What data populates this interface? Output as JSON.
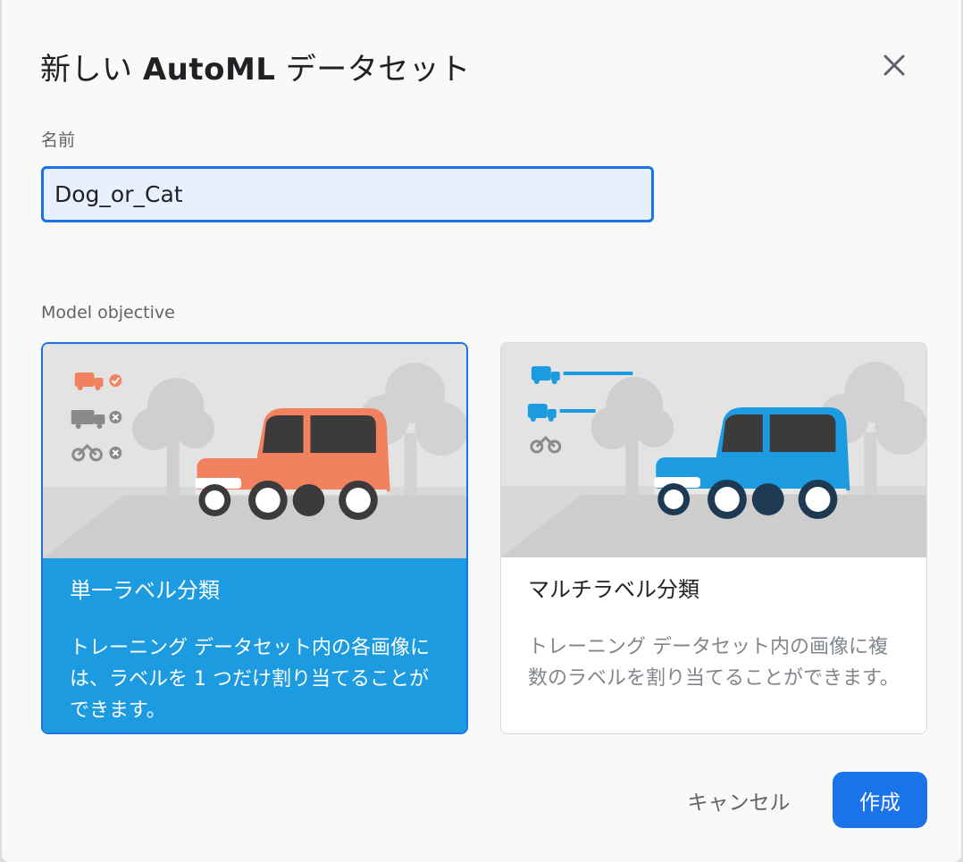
{
  "dialog": {
    "title_prefix": "新しい ",
    "title_brand": "AutoML",
    "title_suffix": " データセット",
    "close_icon": "close-icon"
  },
  "name_field": {
    "label": "名前",
    "value": "Dog_or_Cat"
  },
  "objective": {
    "label": "Model objective",
    "options": [
      {
        "title": "単一ラベル分類",
        "description": "トレーニング データセット内の各画像には、ラベルを 1 つだけ割り当てることができます。",
        "selected": true,
        "accent_color": "#f2825f",
        "icon": "single-label-car-illustration"
      },
      {
        "title": "マルチラベル分類",
        "description": "トレーニング データセット内の画像に複数のラベルを割り当てることができます。",
        "selected": false,
        "accent_color": "#1c9be0",
        "icon": "multi-label-car-illustration"
      }
    ]
  },
  "actions": {
    "cancel": "キャンセル",
    "create": "作成"
  },
  "colors": {
    "primary": "#1a73e8",
    "selected_card": "#1c9be0"
  }
}
